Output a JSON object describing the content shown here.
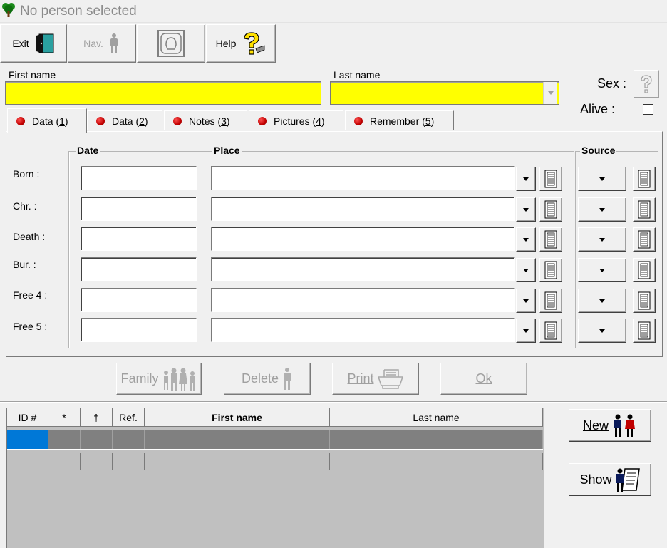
{
  "window": {
    "title": "No person selected",
    "icon": "tree-icon"
  },
  "toolbar": {
    "exit_label": "Exit",
    "nav_label": "Nav.",
    "help_label": "Help"
  },
  "header": {
    "first_name_label": "First name",
    "last_name_label": "Last name",
    "first_name_value": "",
    "last_name_value": "",
    "sex_label": "Sex :",
    "alive_label": "Alive :",
    "alive_checked": false,
    "field_color": "#ffff00"
  },
  "tabs": [
    {
      "label": "Data (",
      "key": "1",
      "suffix": ")",
      "active": true
    },
    {
      "label": "Data (",
      "key": "2",
      "suffix": ")",
      "active": false
    },
    {
      "label": "Notes (",
      "key": "3",
      "suffix": ")",
      "active": false
    },
    {
      "label": "Pictures (",
      "key": "4",
      "suffix": ")",
      "active": false
    },
    {
      "label": "Remember (",
      "key": "5",
      "suffix": ")",
      "active": false
    }
  ],
  "data_panel": {
    "date_header": "Date",
    "place_header": "Place",
    "source_header": "Source",
    "rows": [
      {
        "label": "Born :",
        "date": "",
        "place": ""
      },
      {
        "label": "Chr. :",
        "date": "",
        "place": ""
      },
      {
        "label": "Death :",
        "date": "",
        "place": ""
      },
      {
        "label": "Bur. :",
        "date": "",
        "place": ""
      },
      {
        "label": "Free 4 :",
        "date": "",
        "place": ""
      },
      {
        "label": "Free 5 :",
        "date": "",
        "place": ""
      }
    ]
  },
  "actions": {
    "family_label": "Family",
    "delete_label": "Delete",
    "print_label": "Print",
    "ok_label": "Ok"
  },
  "grid": {
    "columns": [
      "ID #",
      "*",
      "†",
      "Ref.",
      "First name",
      "Last name"
    ],
    "selected_color": "#0078d7",
    "row_color": "#808080"
  },
  "side": {
    "new_label": "New",
    "show_label": "Show"
  }
}
